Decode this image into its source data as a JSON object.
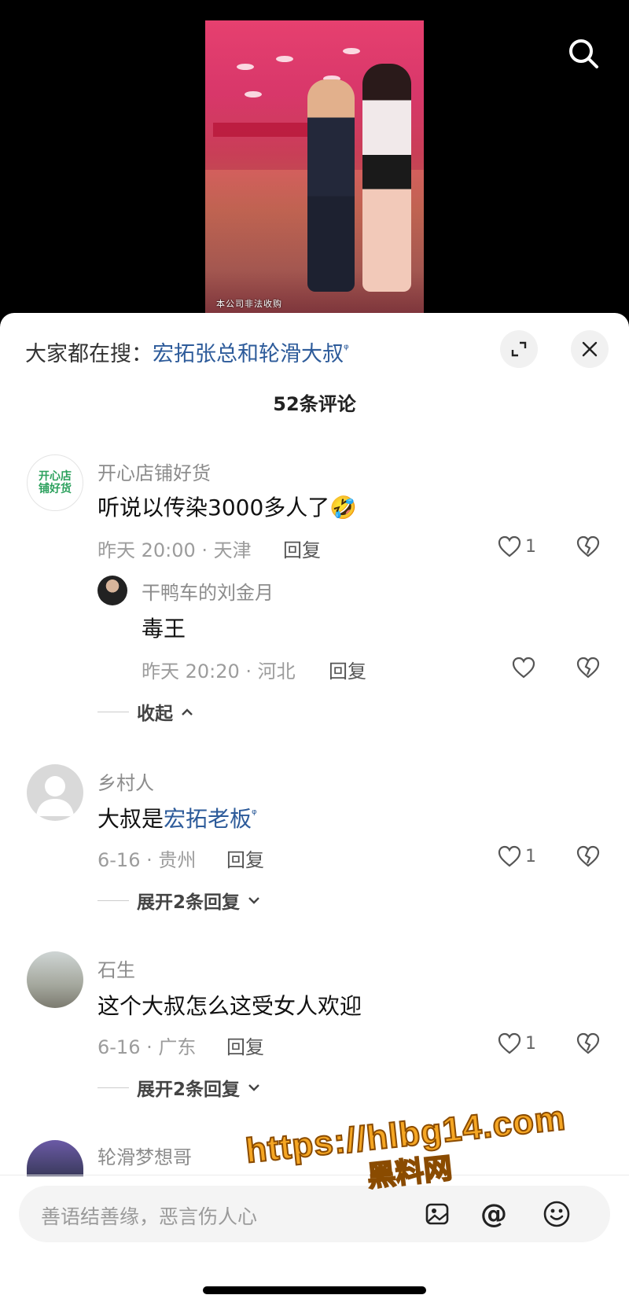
{
  "video": {
    "caption": "本公司非法收购"
  },
  "hot_search": {
    "prefix": "大家都在搜：",
    "query": "宏拓张总和轮滑大叔"
  },
  "comment_count": "52条评论",
  "comments": [
    {
      "username": "开心店铺好货",
      "avatar_text": [
        "开心店",
        "铺好货"
      ],
      "text": "听说以传染3000多人了🤣",
      "time": "昨天 20:00 · 天津",
      "reply": "回复",
      "likes": "1",
      "replies": [
        {
          "username": "干鸭车的刘金月",
          "text": "毒王",
          "time": "昨天 20:20 · 河北",
          "reply": "回复"
        }
      ],
      "toggle": "收起"
    },
    {
      "username": "乡村人",
      "text_prefix": "大叔是",
      "text_link": "宏拓老板",
      "time": "6-16 · 贵州",
      "reply": "回复",
      "likes": "1",
      "toggle": "展开2条回复"
    },
    {
      "username": "石生",
      "text": "这个大叔怎么这受女人欢迎",
      "time": "6-16 · 广东",
      "reply": "回复",
      "likes": "1",
      "toggle": "展开2条回复"
    },
    {
      "username": "轮滑梦想哥"
    }
  ],
  "input": {
    "placeholder": "善语结善缘，恶言伤人心"
  },
  "watermark": {
    "url": "https://hlbg14.com",
    "site": "黑料网"
  },
  "colors": {
    "link": "#2d5b9a",
    "muted": "#9c9c9c",
    "watermark": "#f5a623"
  }
}
